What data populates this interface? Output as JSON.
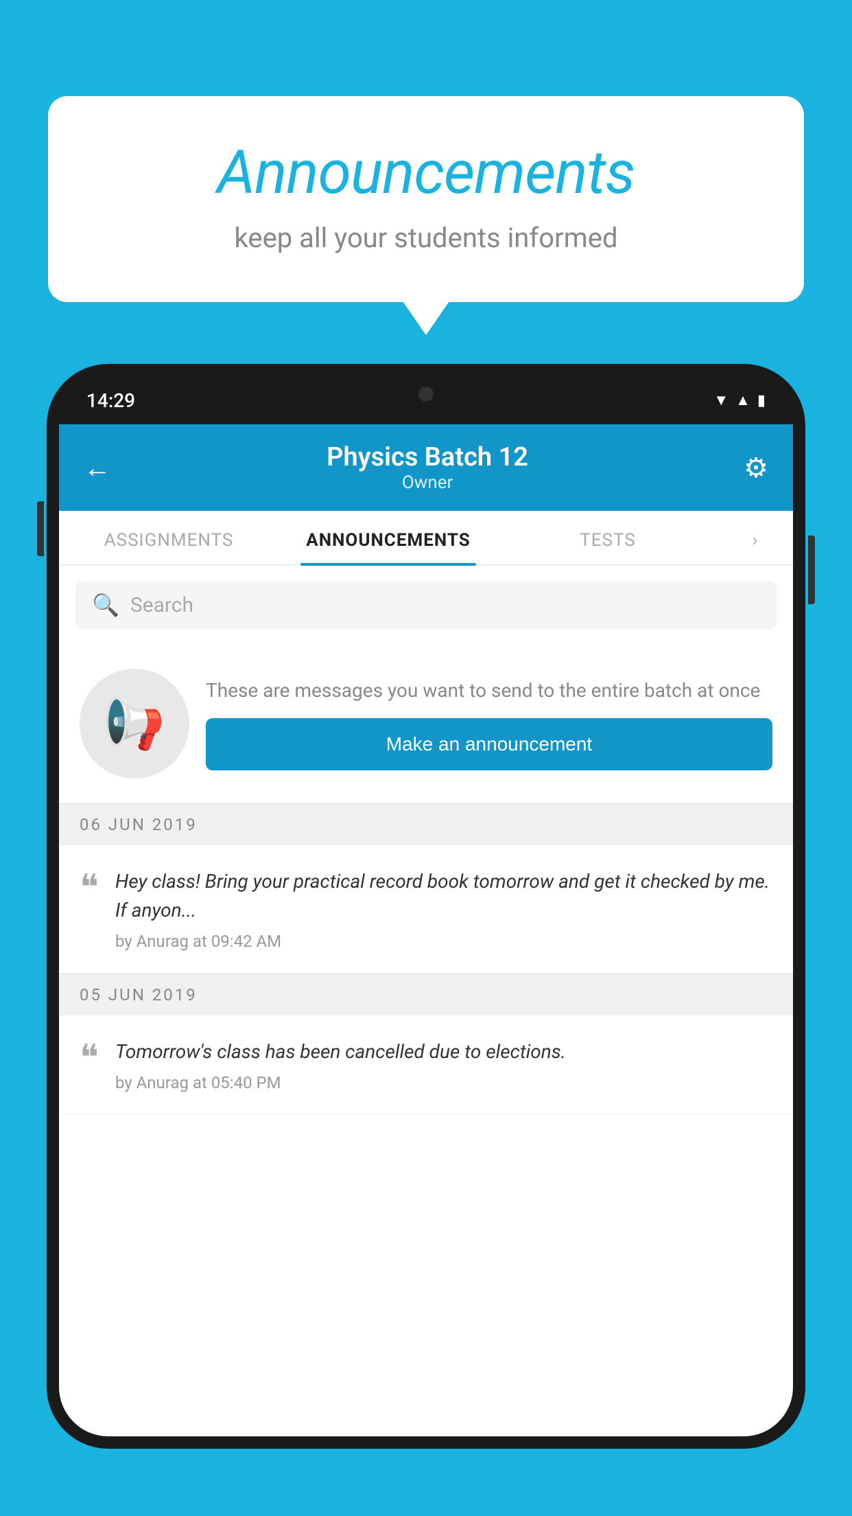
{
  "background_color": "#1ab3e0",
  "speech_bubble": {
    "title": "Announcements",
    "subtitle": "keep all your students informed"
  },
  "phone": {
    "status_bar": {
      "time": "14:29"
    },
    "header": {
      "back_label": "←",
      "title": "Physics Batch 12",
      "subtitle": "Owner",
      "gear_icon": "⚙"
    },
    "tabs": [
      {
        "label": "ASSIGNMENTS",
        "active": false
      },
      {
        "label": "ANNOUNCEMENTS",
        "active": true
      },
      {
        "label": "TESTS",
        "active": false
      },
      {
        "label": "...",
        "active": false
      }
    ],
    "search": {
      "placeholder": "Search"
    },
    "promo": {
      "description": "These are messages you want to send to the entire batch at once",
      "button_label": "Make an announcement"
    },
    "announcements": [
      {
        "date": "06  JUN  2019",
        "text": "Hey class! Bring your practical record book tomorrow and get it checked by me. If anyon...",
        "meta": "by Anurag at 09:42 AM"
      },
      {
        "date": "05  JUN  2019",
        "text": "Tomorrow's class has been cancelled due to elections.",
        "meta": "by Anurag at 05:40 PM"
      }
    ]
  }
}
